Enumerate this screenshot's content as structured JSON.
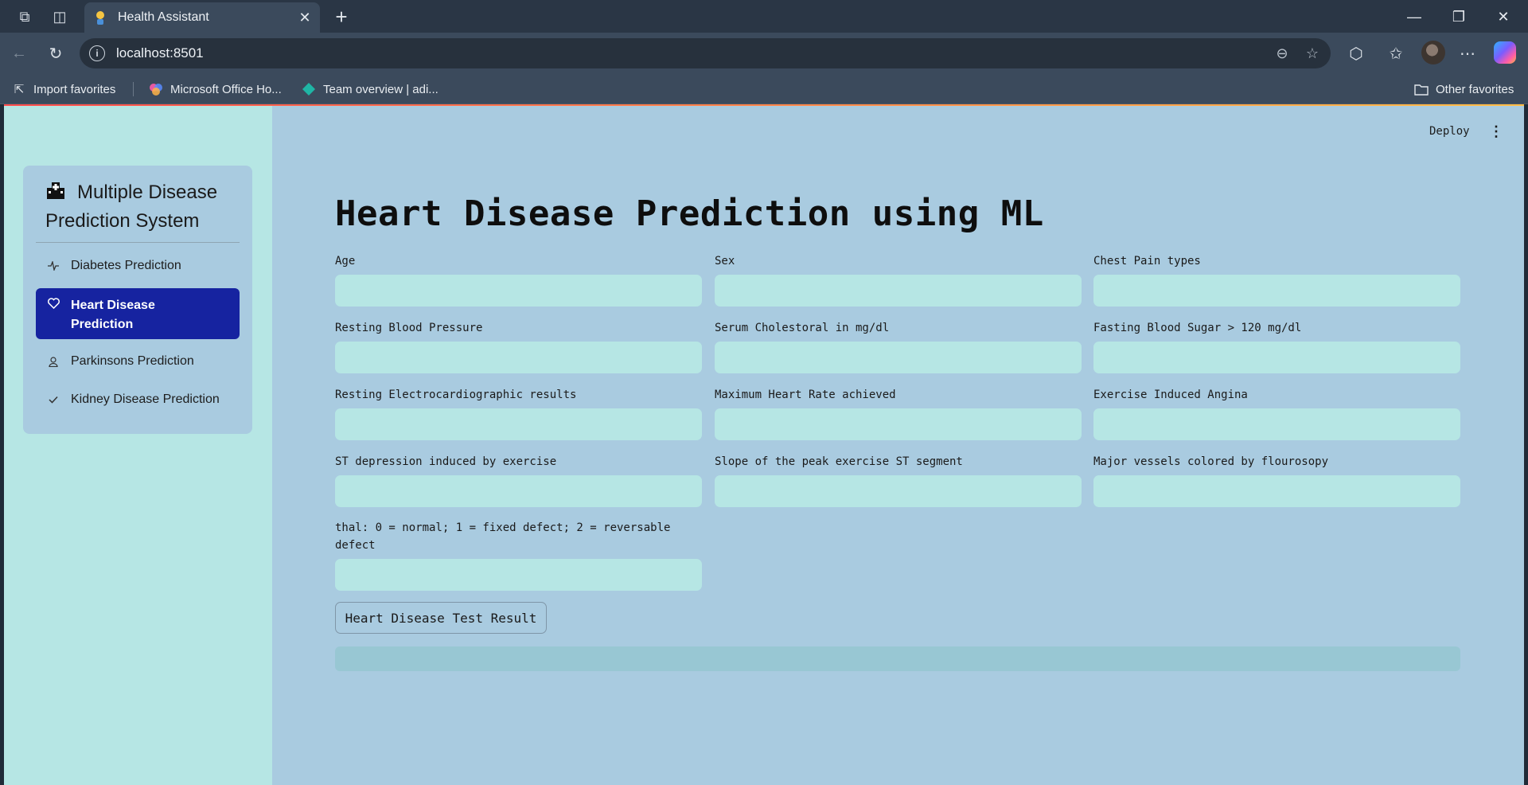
{
  "browser": {
    "tab_title": "Health Assistant",
    "url": "localhost:8501",
    "favorites": [
      {
        "label": "Import favorites"
      },
      {
        "label": "Microsoft Office Ho..."
      },
      {
        "label": "Team overview | adi..."
      }
    ],
    "other_favorites": "Other favorites"
  },
  "header": {
    "deploy_label": "Deploy"
  },
  "sidebar": {
    "title": "Multiple Disease Prediction System",
    "items": [
      {
        "label": "Diabetes Prediction",
        "icon": "activity-icon",
        "active": false
      },
      {
        "label": "Heart Disease Prediction",
        "icon": "heart-icon",
        "active": true
      },
      {
        "label": "Parkinsons Prediction",
        "icon": "person-icon",
        "active": false
      },
      {
        "label": "Kidney Disease Prediction",
        "icon": "check-icon",
        "active": false
      }
    ]
  },
  "main": {
    "title": "Heart Disease Prediction using ML",
    "fields": [
      {
        "label": "Age",
        "value": ""
      },
      {
        "label": "Sex",
        "value": ""
      },
      {
        "label": "Chest Pain types",
        "value": ""
      },
      {
        "label": "Resting Blood Pressure",
        "value": ""
      },
      {
        "label": "Serum Cholestoral in mg/dl",
        "value": ""
      },
      {
        "label": "Fasting Blood Sugar > 120 mg/dl",
        "value": ""
      },
      {
        "label": "Resting Electrocardiographic results",
        "value": ""
      },
      {
        "label": "Maximum Heart Rate achieved",
        "value": ""
      },
      {
        "label": "Exercise Induced Angina",
        "value": ""
      },
      {
        "label": "ST depression induced by exercise",
        "value": ""
      },
      {
        "label": "Slope of the peak exercise ST segment",
        "value": ""
      },
      {
        "label": "Major vessels colored by flourosopy",
        "value": ""
      },
      {
        "label": "thal: 0 = normal; 1 = fixed defect; 2 = reversable defect",
        "value": ""
      }
    ],
    "submit_label": "Heart Disease Test Result",
    "result_text": ""
  },
  "colors": {
    "sidebar_bg": "#b6e6e4",
    "main_bg": "#a9cbe0",
    "active_item": "#1623a0"
  }
}
